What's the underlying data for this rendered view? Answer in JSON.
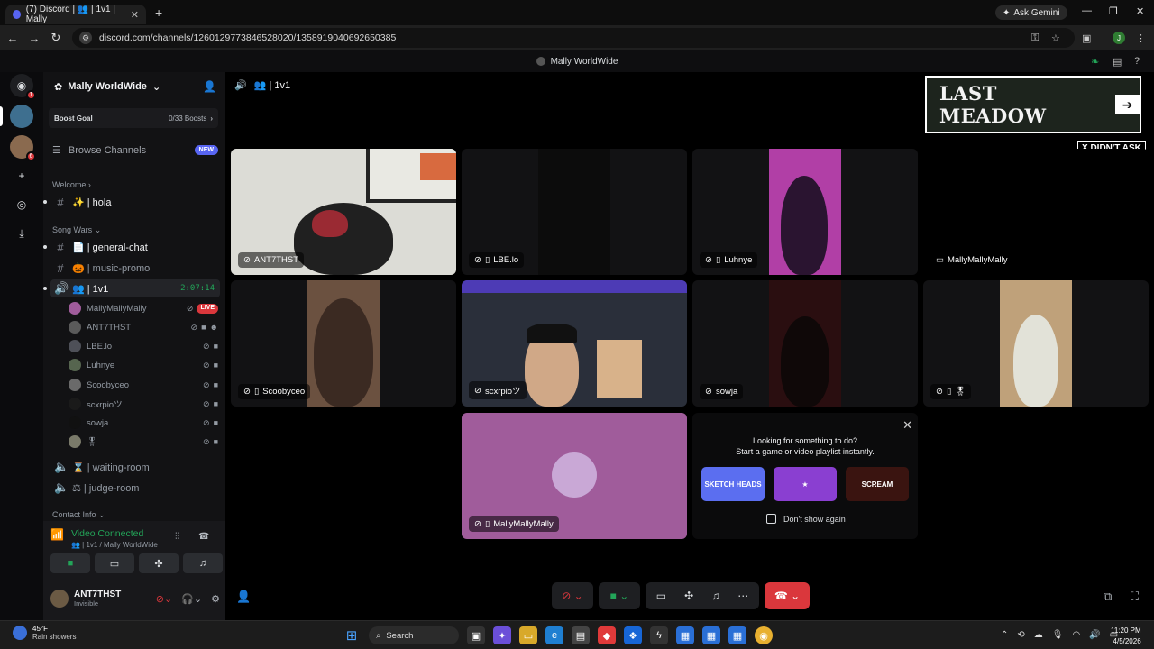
{
  "browser": {
    "tab_title": "(7) Discord | 👥 | 1v1 | Mally",
    "new_tab": "+",
    "ask_gemini": "Ask Gemini",
    "url": "discord.com/channels/1260129773846528020/1358919040692650385"
  },
  "discord": {
    "window_title": "Mally WorldWide"
  },
  "server": {
    "name": "Mally WorldWide",
    "boost_goal": "Boost Goal",
    "boost_count": "0/33 Boosts",
    "browse_channels": "Browse Channels",
    "new_badge": "NEW"
  },
  "categories": {
    "welcome": "Welcome",
    "song_wars": "Song Wars",
    "contact_info": "Contact Info"
  },
  "channels": {
    "hola": "✨ | hola",
    "general_chat": "📄 | general-chat",
    "music_promo": "🎃 | music-promo",
    "voice_1v1": "👥 | 1v1",
    "voice_timer": "2:07:14",
    "waiting_room": "⌛ | waiting-room",
    "judge_room": "⚖ | judge-room"
  },
  "voice_members": [
    {
      "name": "MallyMallyMally",
      "live": "LIVE"
    },
    {
      "name": "ANT7THST"
    },
    {
      "name": "LBE.lo"
    },
    {
      "name": "Luhnye"
    },
    {
      "name": "Scoobyceo"
    },
    {
      "name": "scxrpioツ"
    },
    {
      "name": "sowja"
    },
    {
      "name": "🎖"
    }
  ],
  "voice_panel": {
    "status": "Video Connected",
    "channel": "👥 | 1v1 / Mally WorldWide"
  },
  "user": {
    "name": "ANT7THST",
    "status": "Invisible"
  },
  "stage": {
    "channel": "👥 | 1v1",
    "banner_text": "LAST MEADOW",
    "banner_arrow": "➔",
    "sticker": "X DIDN'T ASK",
    "tiles": [
      {
        "label": "ANT7THST"
      },
      {
        "label": "LBE.lo"
      },
      {
        "label": "Luhnye"
      },
      {
        "label": "MallyMallyMally"
      },
      {
        "label": "Scoobyceo"
      },
      {
        "label": "scxrpioツ"
      },
      {
        "label": "sowja"
      },
      {
        "label": "🎖"
      },
      {
        "label": "MallyMallyMally"
      }
    ],
    "activity": {
      "line1": "Looking for something to do?",
      "line2": "Start a game or video playlist instantly.",
      "dont_show": "Don't show again",
      "cards": [
        "SKETCH HEADS",
        "★",
        "SCREAM"
      ]
    }
  },
  "taskbar": {
    "temp": "45°F",
    "weather": "Rain showers",
    "search": "Search",
    "time": "11:20 PM",
    "date": "4/5/2026"
  },
  "colors": {
    "accent": "#5865f2",
    "green": "#23a559",
    "red": "#da373c",
    "activity_tile": "#a05c9b"
  }
}
